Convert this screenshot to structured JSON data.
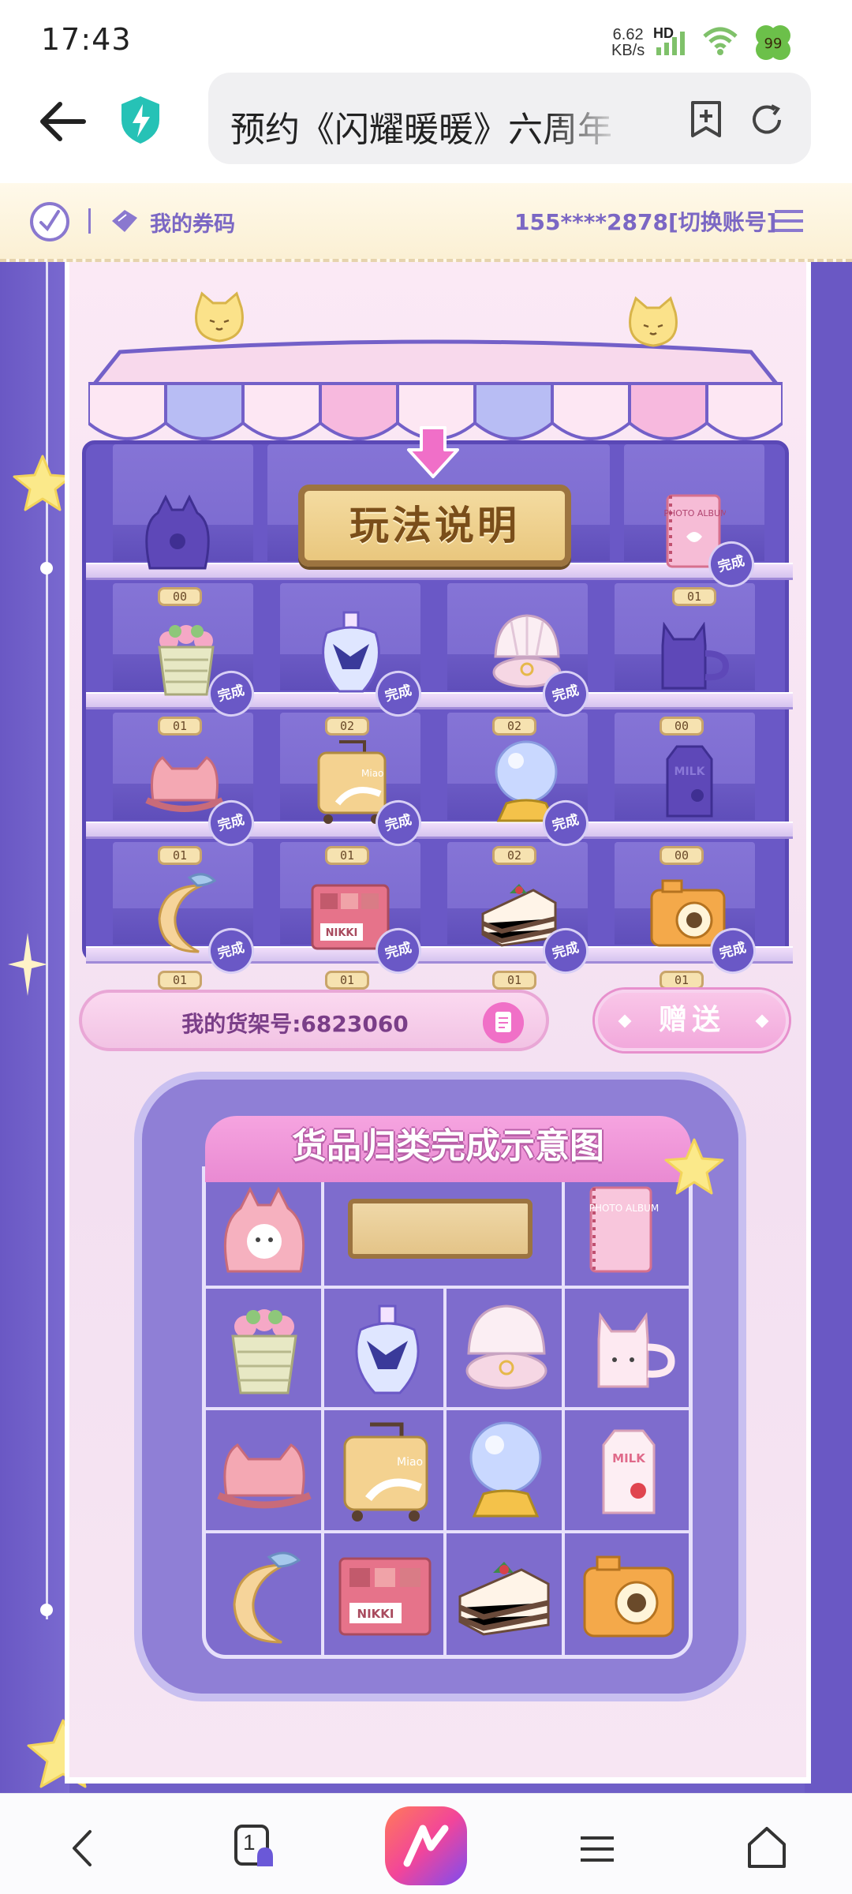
{
  "status_bar": {
    "time": "17:43",
    "net_speed_value": "6.62",
    "net_speed_unit": "KB/s",
    "network_badge": "HD",
    "icons": [
      "signal-icon",
      "wifi-icon",
      "clover-icon"
    ]
  },
  "browser": {
    "url_title": "预约《闪耀暖暖》六周年",
    "icons": [
      "back-arrow-icon",
      "shield-icon",
      "add-bookmark-icon",
      "reload-icon"
    ]
  },
  "page_header": {
    "coupons_label": "我的券码",
    "account_label": "155****2878[切换账号]"
  },
  "shelf": {
    "rules_button": "玩法说明",
    "done_label": "完成",
    "counts": {
      "row1": [
        "00",
        "01"
      ],
      "row2": [
        "01",
        "02",
        "02",
        "00"
      ],
      "row3": [
        "01",
        "01",
        "02",
        "00"
      ],
      "row4": [
        "01",
        "01",
        "01",
        "01"
      ]
    },
    "item_text": {
      "photo_album": "PHOTO ALBUM",
      "milk": "MILK",
      "nikki": "NIKKI",
      "miao": "Miao"
    }
  },
  "controls": {
    "shelf_number": "我的货架号:6823060",
    "gift_button": "赠送"
  },
  "diagram": {
    "title": "货品归类完成示意图"
  },
  "bottom_nav": {
    "tab_count": "1",
    "icons": [
      "nav-back-icon",
      "tabs-icon",
      "browser-logo-icon",
      "nav-menu-icon",
      "home-icon"
    ]
  },
  "colors": {
    "primary_purple": "#6f5fc7",
    "accent_pink": "#f2a9dc",
    "gold": "#e9c77e"
  }
}
